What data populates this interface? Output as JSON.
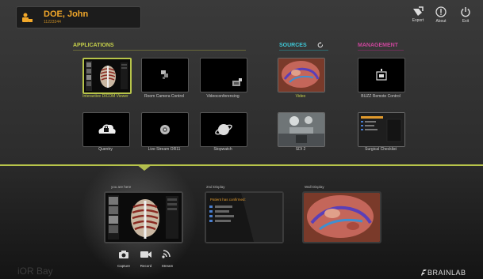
{
  "patient": {
    "name": "DOE, John",
    "id": "11223344"
  },
  "toolbar": {
    "export": "Export",
    "about": "About",
    "exit": "Exit"
  },
  "sections": {
    "applications": "APPLICATIONS",
    "sources": "SOURCES",
    "management": "MANAGEMENT"
  },
  "colors": {
    "accent_yellow": "#b7c44a",
    "sources_cyan": "#3ec7d6",
    "management_pink": "#c9469a",
    "patient_orange": "#f2a82a"
  },
  "applications": [
    {
      "label": "Interactive DICOM Viewer",
      "selected": true,
      "icon": "ribcage-thumbnail"
    },
    {
      "label": "Room Camera Control",
      "icon": "camera-control-icon"
    },
    {
      "label": "Videoconferencing",
      "icon": "videoconference-icon"
    },
    {
      "label": "Quentry",
      "icon": "cloud-icon"
    },
    {
      "label": "Live Stream OR11",
      "icon": "live-stream-icon"
    },
    {
      "label": "Stopwatch",
      "icon": "stopwatch-icon"
    }
  ],
  "sources": [
    {
      "label": "Video",
      "icon": "surgical-video-thumbnail"
    },
    {
      "label": "SDI 2",
      "icon": "operating-room-thumbnail"
    }
  ],
  "management": [
    {
      "label": "BUZZ Remote Control",
      "icon": "remote-control-icon"
    },
    {
      "label": "Surgical Checklist",
      "icon": "checklist-thumbnail"
    }
  ],
  "displays": [
    {
      "label": "you are here"
    },
    {
      "label": "2nd Display",
      "content": "Patient has confirmed:"
    },
    {
      "label": "Wall Display"
    }
  ],
  "record_actions": {
    "capture": "Capture",
    "record": "Record",
    "stream": "Stream"
  },
  "brand": "iOR Bay",
  "vendor": "BRAINLAB"
}
